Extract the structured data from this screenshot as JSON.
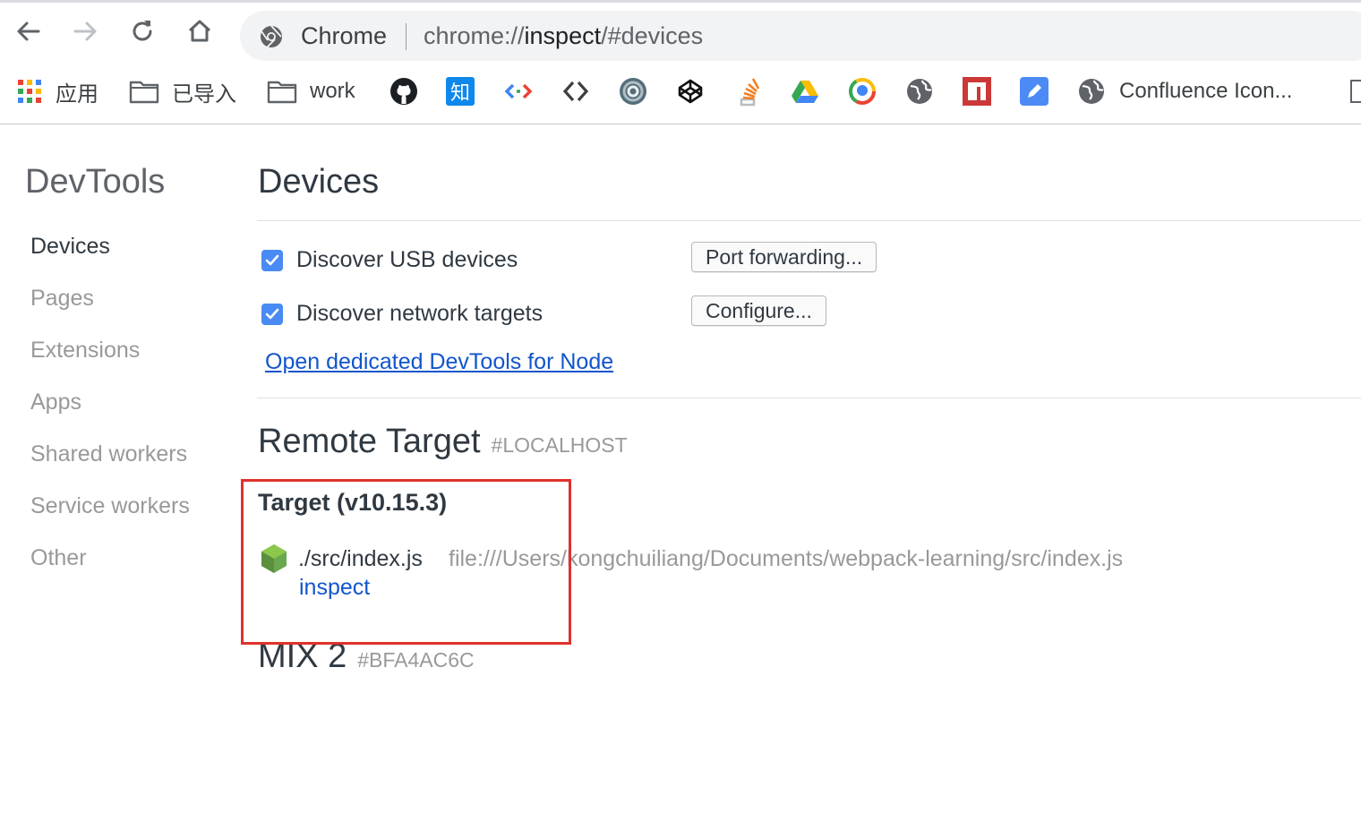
{
  "browser": {
    "omnibox": {
      "chip": "Chrome",
      "url_scheme": "chrome://",
      "url_host": "inspect",
      "url_path": "/#devices"
    },
    "bookmarks": [
      {
        "label": "应用",
        "icon": "apps-grid-icon"
      },
      {
        "label": "已导入",
        "icon": "folder-icon"
      },
      {
        "label": "work",
        "icon": "folder-icon"
      },
      {
        "icon": "github-icon"
      },
      {
        "icon": "zhihu-icon",
        "glyph": "知"
      },
      {
        "icon": "code-brackets-icon"
      },
      {
        "icon": "diamond-brackets-icon"
      },
      {
        "icon": "swirl-icon"
      },
      {
        "icon": "codepen-icon"
      },
      {
        "icon": "stackoverflow-icon"
      },
      {
        "icon": "google-drive-icon"
      },
      {
        "icon": "circle-logo-icon"
      },
      {
        "icon": "globe-icon"
      },
      {
        "icon": "npm-icon"
      },
      {
        "icon": "edit-note-icon"
      },
      {
        "label": "Confluence Icon...",
        "icon": "globe-icon"
      }
    ]
  },
  "sidebar": {
    "title": "DevTools",
    "items": [
      {
        "label": "Devices",
        "selected": true
      },
      {
        "label": "Pages"
      },
      {
        "label": "Extensions"
      },
      {
        "label": "Apps"
      },
      {
        "label": "Shared workers"
      },
      {
        "label": "Service workers"
      },
      {
        "label": "Other"
      }
    ]
  },
  "main": {
    "title": "Devices",
    "discover_usb": {
      "label": "Discover USB devices",
      "checked": true
    },
    "discover_network": {
      "label": "Discover network targets",
      "checked": true
    },
    "port_forwarding_button": "Port forwarding...",
    "configure_button": "Configure...",
    "node_link": "Open dedicated DevTools for Node",
    "remote_target": {
      "title": "Remote Target",
      "id": "#LOCALHOST",
      "target_name": "Target (v10.15.3)",
      "file": "./src/index.js",
      "url": "file:///Users/kongchuiliang/Documents/webpack-learning/src/index.js",
      "action": "inspect"
    },
    "device": {
      "name": "MIX 2",
      "id": "#BFA4AC6C"
    }
  },
  "colors": {
    "link": "#1155cc",
    "checkbox": "#4a8af4",
    "highlight": "#e0312b",
    "node_green": "#6aa84f"
  }
}
